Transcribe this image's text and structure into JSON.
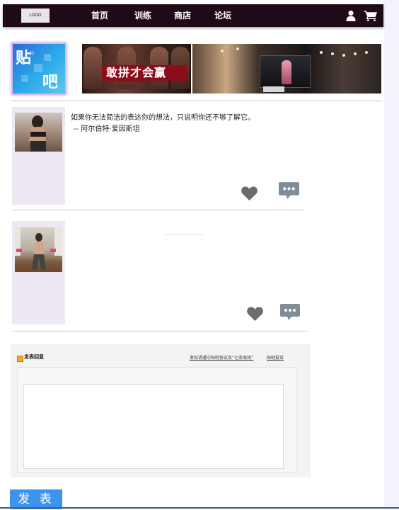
{
  "navbar": {
    "logo_text": "LOGO",
    "items": [
      {
        "label": "首页"
      },
      {
        "label": "训练"
      },
      {
        "label": "商店"
      },
      {
        "label": "论坛"
      }
    ],
    "icons": {
      "user": "user-icon",
      "cart": "cart-icon"
    }
  },
  "banner": {
    "forum_logo_chars": [
      "贴",
      "吧"
    ],
    "slogan": "敢拼才会赢"
  },
  "posts": [
    {
      "quote": "如果你无法简洁的表达你的想法，只说明你还不够了解它。",
      "author": "-- 阿尔伯特·爱因斯坦",
      "icons": {
        "like": "heart-icon",
        "comment": "comment-icon"
      }
    },
    {
      "quote": "",
      "author": "",
      "icons": {
        "like": "heart-icon",
        "comment": "comment-icon"
      }
    }
  ],
  "reply": {
    "title": "发表回复",
    "link_help": "发帖请遵守贴吧协议及“七条底线”",
    "link_report": "贴吧投诉",
    "submit_label": "发 表"
  },
  "colors": {
    "navbar_bg": "#1f0a1a",
    "submit_bg": "#3c94ee",
    "sidebar_bg": "#efe8f3",
    "icon_gray": "#6e6a6d"
  }
}
